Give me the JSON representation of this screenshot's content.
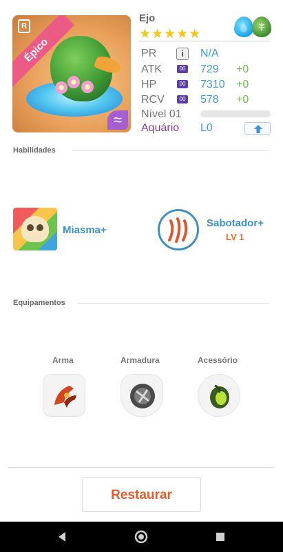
{
  "card": {
    "rarity_ribbon": "Épico",
    "rarity_badge": "R",
    "type_badge": "≈"
  },
  "monster": {
    "name": "Ejo",
    "stars": 5,
    "elements": [
      "water-drop-icon",
      "leaf-icon"
    ]
  },
  "stats": {
    "pr": {
      "label": "PR",
      "value": "N/A"
    },
    "atk": {
      "label": "ATK",
      "value": "729",
      "bonus": "+0",
      "icon_text": "00"
    },
    "hp": {
      "label": "HP",
      "value": "7310",
      "bonus": "+0",
      "icon_text": "00"
    },
    "rcv": {
      "label": "RCV",
      "value": "578",
      "bonus": "+0",
      "icon_text": "00"
    },
    "level": {
      "label": "Nível 01",
      "progress": 0
    },
    "aquarium": {
      "label": "Aquário",
      "value": "L0"
    }
  },
  "sections": {
    "abilities": "Habilidades",
    "equipment": "Equipamentos"
  },
  "abilities": {
    "active": {
      "name": "Miasma+"
    },
    "leader": {
      "name": "Sabotador+",
      "level": "LV 1"
    }
  },
  "equipment": {
    "weapon": "Arma",
    "armor": "Armadura",
    "accessory": "Acessório"
  },
  "actions": {
    "restore": "Restaurar"
  },
  "colors": {
    "accent_blue": "#3f8fc7",
    "accent_orange": "#ec5a2a",
    "ribbon_pink": "#ec5b86",
    "star_yellow": "#f8c517",
    "bonus_green": "#6ac04a"
  }
}
